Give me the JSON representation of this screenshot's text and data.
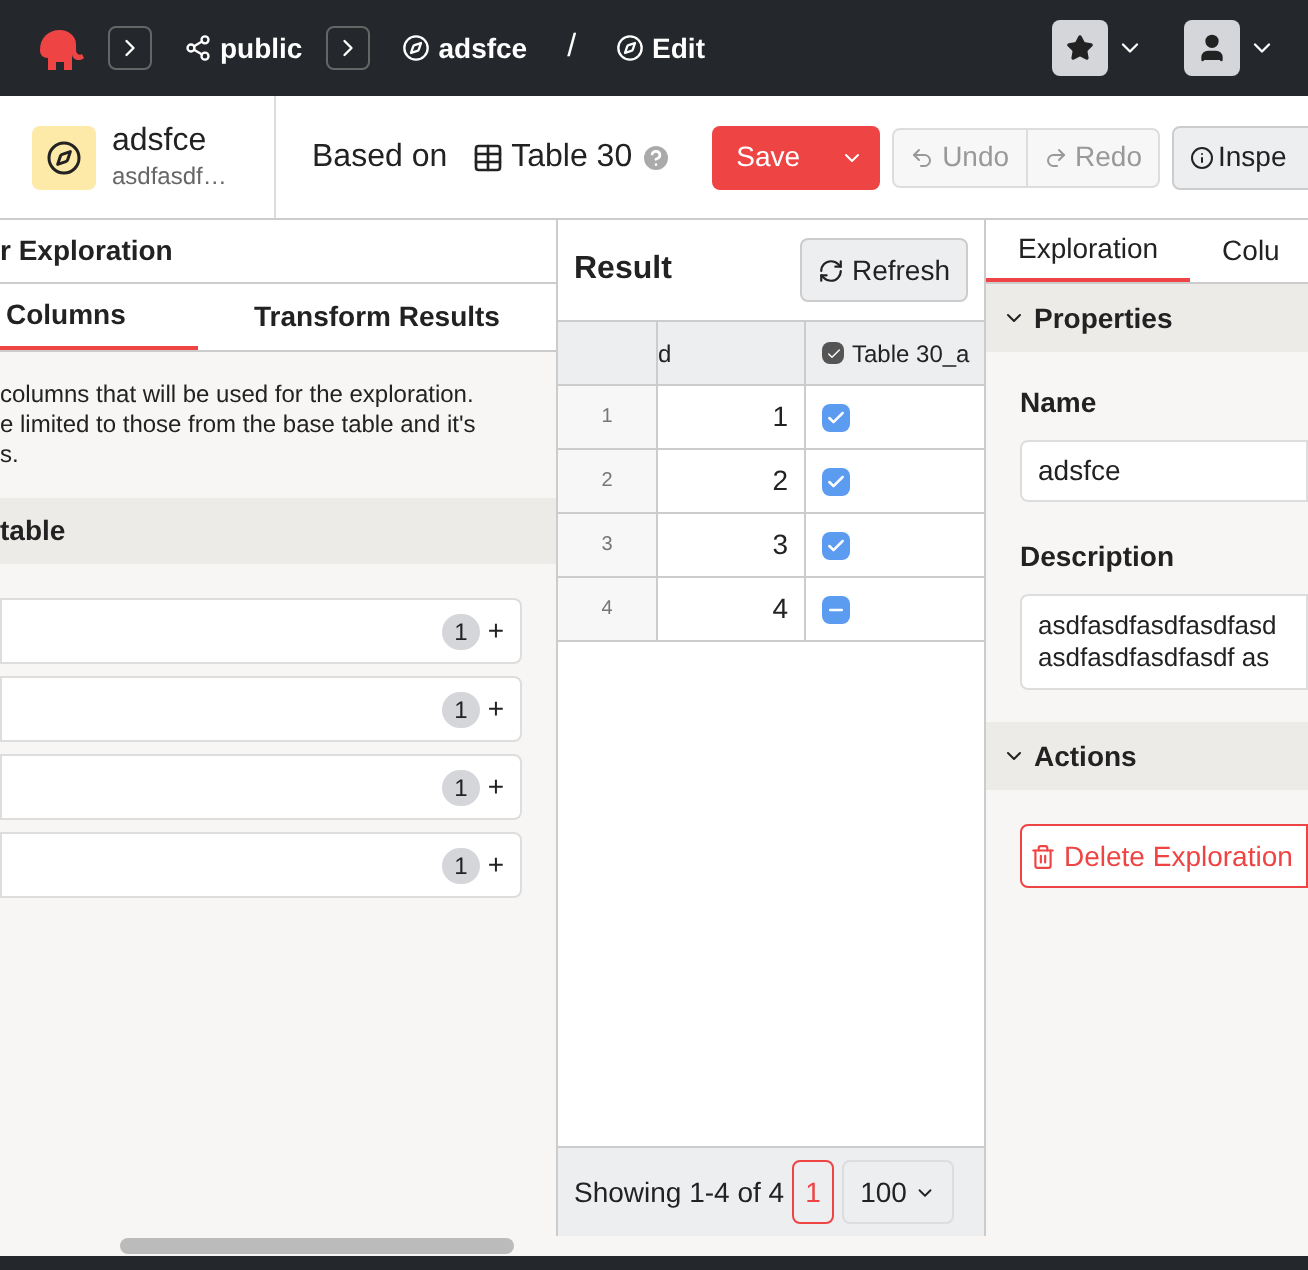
{
  "breadcrumbs": [
    {
      "kind": "schema",
      "label": "public"
    },
    {
      "kind": "exploration",
      "label": "adsfce"
    },
    {
      "kind": "mode",
      "label": "Edit"
    }
  ],
  "separator": "/",
  "header": {
    "title": "adsfce",
    "subtitle": "asdfasdf…",
    "based_on_label": "Based on",
    "base_table": "Table 30",
    "save": "Save",
    "undo": "Undo",
    "redo": "Redo",
    "inspect": "Inspe"
  },
  "left_panel": {
    "title": "r Exploration",
    "tabs": [
      {
        "label": "Columns",
        "selected": true
      },
      {
        "label": "Transform Results",
        "selected": false
      }
    ],
    "help_lines": [
      "columns that will be used for the exploration.",
      "e limited to those from the base table and it's",
      "s."
    ],
    "section": "table",
    "rows": [
      {
        "count": "1",
        "add": "+"
      },
      {
        "count": "1",
        "add": "+"
      },
      {
        "count": "1",
        "add": "+"
      },
      {
        "count": "1",
        "add": "+"
      }
    ]
  },
  "result": {
    "title": "Result",
    "refresh": "Refresh",
    "columns": [
      "d",
      "Table 30_a"
    ],
    "rows": [
      {
        "number": "1",
        "value": "1",
        "checked": true,
        "indeterminate": false
      },
      {
        "number": "2",
        "value": "2",
        "checked": true,
        "indeterminate": false
      },
      {
        "number": "3",
        "value": "3",
        "checked": true,
        "indeterminate": false
      },
      {
        "number": "4",
        "value": "4",
        "checked": true,
        "indeterminate": true
      }
    ],
    "footer": "Showing 1-4 of 4",
    "page": "1",
    "page_size": "100"
  },
  "right_panel": {
    "tabs": [
      {
        "label": "Exploration",
        "selected": true
      },
      {
        "label": "Colu",
        "selected": false
      }
    ],
    "sections": [
      {
        "title": "Properties",
        "expanded": true
      },
      {
        "title": "Actions",
        "expanded": true
      }
    ],
    "name_label": "Name",
    "name_value": "adsfce",
    "description_label": "Description",
    "description_lines": [
      "asdfasdfasdfasdfasd",
      "asdfasdfasdfasdf as"
    ],
    "delete": "Delete Exploration"
  }
}
